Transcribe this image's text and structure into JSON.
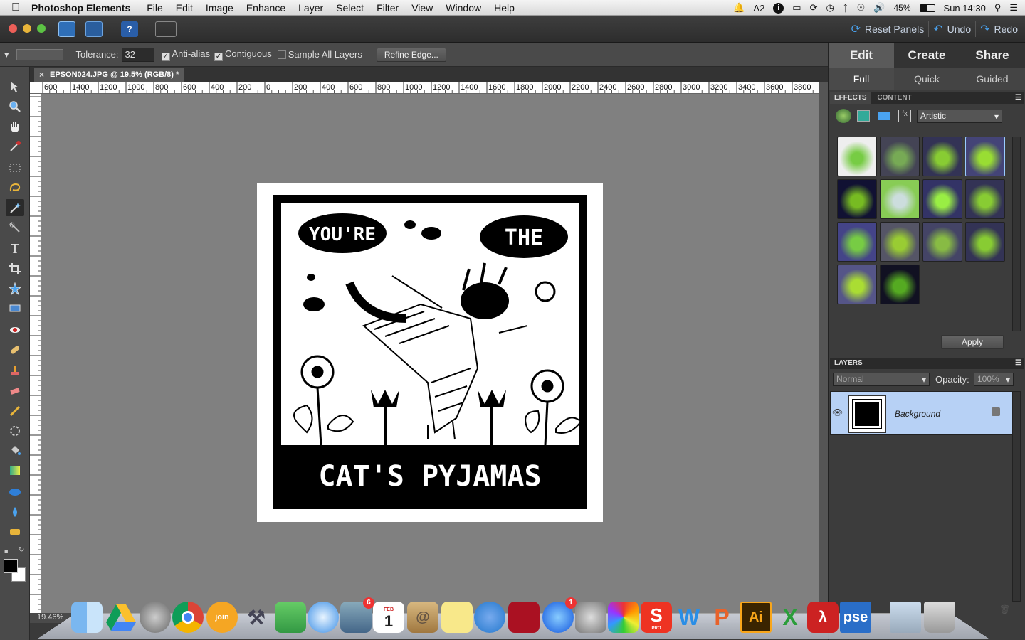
{
  "menubar": {
    "app_name": "Photoshop Elements",
    "menus": [
      "File",
      "Edit",
      "Image",
      "Enhance",
      "Layer",
      "Select",
      "Filter",
      "View",
      "Window",
      "Help"
    ],
    "status": {
      "notification_badge": "2",
      "battery": "45%",
      "clock": "Sun 14:30"
    }
  },
  "appbar": {
    "reset_panels": "Reset Panels",
    "undo": "Undo",
    "redo": "Redo"
  },
  "options": {
    "tolerance_label": "Tolerance:",
    "tolerance_value": "32",
    "anti_alias": "Anti-alias",
    "contiguous": "Contiguous",
    "sample_all_layers": "Sample All Layers",
    "refine_edge": "Refine Edge..."
  },
  "document": {
    "tab_title": "EPSON024.JPG @ 19.5% (RGB/8) *",
    "zoom_status": "19.46%",
    "ruler_labels": [
      "600",
      "1400",
      "1200",
      "1000",
      "800",
      "600",
      "400",
      "200",
      "0",
      "200",
      "400",
      "600",
      "800",
      "1000",
      "1200",
      "1400",
      "1600",
      "1800",
      "2000",
      "2200",
      "2400",
      "2600",
      "2800",
      "3000",
      "3200",
      "3400",
      "3600",
      "3800",
      "4"
    ],
    "artwork_text": {
      "top_left": "YOU'RE",
      "top_right": "THE",
      "bottom": "CAT'S PYJAMAS"
    }
  },
  "panel": {
    "big_tabs": [
      "Edit",
      "Create",
      "Share"
    ],
    "sub_tabs": [
      "Full",
      "Quick",
      "Guided"
    ],
    "effects_tab": "EFFECTS",
    "content_tab": "CONTENT",
    "filter_category": "Artistic",
    "apply": "Apply",
    "layers_title": "LAYERS",
    "blend_mode": "Normal",
    "opacity_label": "Opacity:",
    "opacity_value": "100%",
    "layer_name": "Background"
  },
  "dock": {
    "badges": {
      "mail": "6",
      "appstore": "1"
    },
    "calendar_day": "1",
    "calendar_month": "FEB",
    "icons": [
      "finder-icon",
      "drive-icon",
      "launchpad-icon",
      "chrome-icon",
      "joinme-icon",
      "helper-icon",
      "spray-icon",
      "safari-icon",
      "mail-icon",
      "calendar-icon",
      "contacts-icon",
      "notes-icon",
      "itunes-icon",
      "photobooth-icon",
      "appstore-icon",
      "sysprefs-icon",
      "picasa-icon",
      "sketchbook-icon",
      "word-icon",
      "powerpoint-icon",
      "illustrator-icon",
      "excel-icon",
      "acrobat-icon",
      "pse-icon",
      "preview-icon",
      "trash-icon"
    ],
    "label_ai": "Ai",
    "label_pse": "pse",
    "label_pro": "PRO"
  },
  "colors": {
    "accent": "#4aa3f0",
    "selected_layer": "#b7d1f5"
  }
}
